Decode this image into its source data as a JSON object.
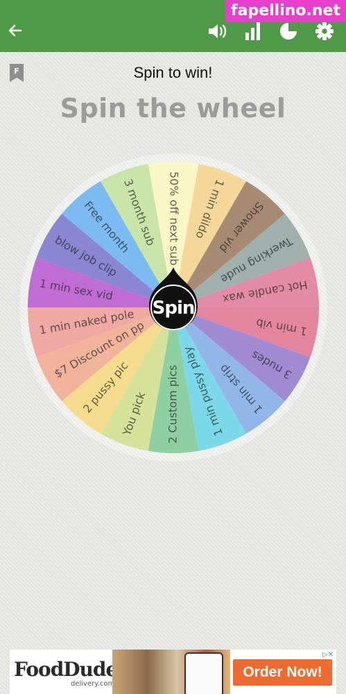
{
  "watermark": "fapellino.net",
  "header": {
    "back_icon": "arrow-left-icon",
    "icons": [
      "volume-icon",
      "bar-chart-icon",
      "pie-chart-icon",
      "gear-icon"
    ],
    "color": "#4f9a47"
  },
  "page": {
    "title": "Spin to win!",
    "heading": "Spin the wheel",
    "bookmark_letter": "F"
  },
  "wheel": {
    "spin_label": "Spin",
    "segments": [
      {
        "label": "50% off next sub",
        "color": "#fbf6c6"
      },
      {
        "label": "1 min dildo",
        "color": "#f6d79a"
      },
      {
        "label": "Shower vid",
        "color": "#a78a74"
      },
      {
        "label": "Twerking nude",
        "color": "#9fb0ad"
      },
      {
        "label": "Hot candle wax",
        "color": "#e28aa6"
      },
      {
        "label": "1 min vib",
        "color": "#e4859f"
      },
      {
        "label": "3 nudes",
        "color": "#a08ad2"
      },
      {
        "label": "1 min strip",
        "color": "#92b6e8"
      },
      {
        "label": "1 min pussy play",
        "color": "#7bd8e8"
      },
      {
        "label": "2 Custom pics",
        "color": "#8ed0a2"
      },
      {
        "label": "You pick",
        "color": "#d6e29a"
      },
      {
        "label": "2 pussy pic",
        "color": "#f5dc8c"
      },
      {
        "label": "$7 Discount on pp",
        "color": "#f2b39d"
      },
      {
        "label": "1 min naked pole",
        "color": "#f0a8a2"
      },
      {
        "label": "1 min sex vid",
        "color": "#bf6cd4"
      },
      {
        "label": "blow job clip",
        "color": "#8b86d2"
      },
      {
        "label": "Free month",
        "color": "#7cbaf2"
      },
      {
        "label": "3 month sub",
        "color": "#c9e4a8"
      }
    ]
  },
  "ad": {
    "brand": "FoodDudes",
    "brand_sub": "delivery.com",
    "cta": "Order Now!",
    "close": "▷✕"
  }
}
